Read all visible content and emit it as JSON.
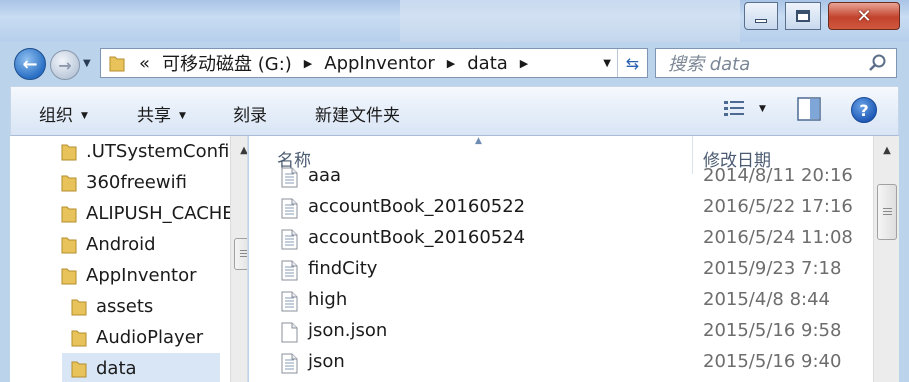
{
  "window": {
    "controls": {
      "minimize_icon": "minimize-icon",
      "maximize_icon": "maximize-icon",
      "close_icon": "close-icon"
    }
  },
  "nav": {
    "back_icon": "back-arrow-icon",
    "forward_icon": "forward-arrow-icon",
    "address": {
      "overflow": "«",
      "crumbs": [
        "可移动磁盘 (G:)",
        "AppInventor",
        "data"
      ]
    },
    "search_placeholder": "搜索 data"
  },
  "toolbar": {
    "organize": "组织",
    "share": "共享",
    "burn": "刻录",
    "new_folder": "新建文件夹"
  },
  "navpane": {
    "items": [
      {
        "label": ".UTSystemConfig",
        "indent": 1
      },
      {
        "label": "360freewifi",
        "indent": 1
      },
      {
        "label": "ALIPUSH_CACHE",
        "indent": 1
      },
      {
        "label": "Android",
        "indent": 1
      },
      {
        "label": "AppInventor",
        "indent": 1
      },
      {
        "label": "assets",
        "indent": 2
      },
      {
        "label": "AudioPlayer",
        "indent": 2
      },
      {
        "label": "data",
        "indent": 2,
        "selected": true
      }
    ]
  },
  "filelist": {
    "columns": {
      "name": "名称",
      "date": "修改日期"
    },
    "rows": [
      {
        "name": "aaa",
        "date": "2014/8/11 20:16",
        "icon": "text-file-icon"
      },
      {
        "name": "accountBook_20160522",
        "date": "2016/5/22 17:16",
        "icon": "text-file-icon"
      },
      {
        "name": "accountBook_20160524",
        "date": "2016/5/24 11:08",
        "icon": "text-file-icon"
      },
      {
        "name": "findCity",
        "date": "2015/9/23 7:18",
        "icon": "text-file-icon"
      },
      {
        "name": "high",
        "date": "2015/4/8 8:44",
        "icon": "text-file-icon"
      },
      {
        "name": "json.json",
        "date": "2015/5/16 9:58",
        "icon": "blank-file-icon"
      },
      {
        "name": "json",
        "date": "2015/5/16 9:40",
        "icon": "text-file-icon"
      }
    ]
  },
  "colors": {
    "accent": "#2a6fc4",
    "selection": "#d8e6f6",
    "close_button": "#c2432d"
  }
}
